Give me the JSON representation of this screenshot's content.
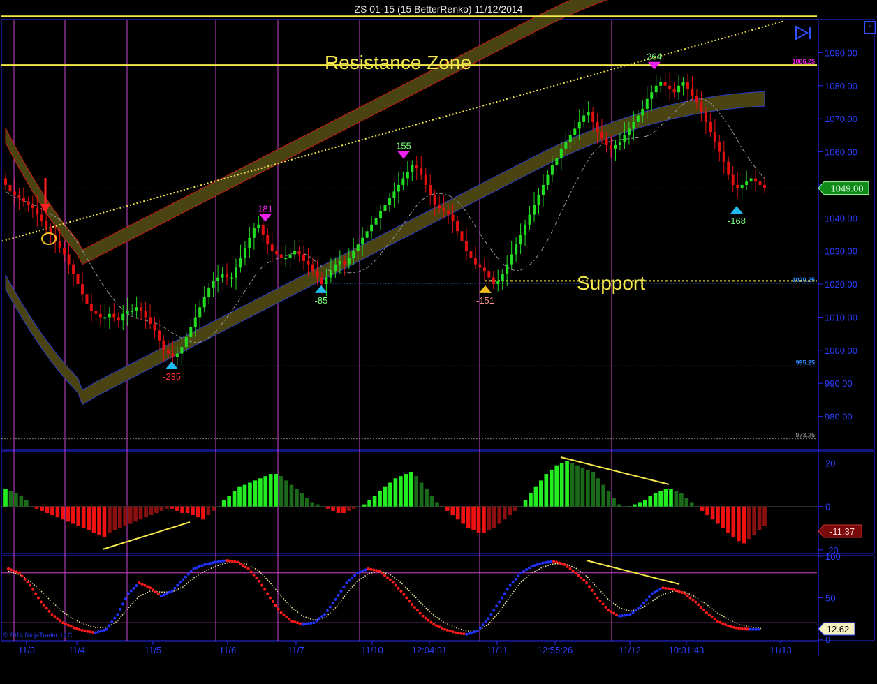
{
  "window": {
    "title": "ZS 01-15 (15 BetterRenko)  11/12/2014",
    "corner_button": "F",
    "copyright": "© 2014 NinjaTrader, LLC"
  },
  "colors": {
    "background": "#000000",
    "axis": "#2a2aff",
    "session_line": "#cc44cc",
    "up_bar": "#22dd22",
    "down_bar": "#e01010",
    "band": "#4a4412",
    "band_upper_edge": "#cc1a1a",
    "band_lower_edge": "#2b3bcc",
    "annotation": "#f5e84a",
    "swing_high": "#ee22ee",
    "swing_low": "#22bbee"
  },
  "chart_data": [
    {
      "type": "candlestick",
      "panel": "price",
      "ylim": [
        970,
        1100
      ],
      "y_ticks": [
        980,
        990,
        1000,
        1010,
        1020,
        1030,
        1040,
        1050,
        1060,
        1070,
        1080,
        1090
      ],
      "y_tick_labels": [
        "980.00",
        "990.00",
        "1000.00",
        "1010.00",
        "1020.00",
        "1030.00",
        "1040.00",
        "1050.00",
        "1060.00",
        "1070.00",
        "1080.00",
        "1090.00"
      ],
      "x_labels": [
        "11/3",
        "11/4",
        "11/5",
        "11/6",
        "11/7",
        "11/10",
        "12:04:31",
        "11/11",
        "12:55:26",
        "11/12",
        "10:31:43",
        "11/13"
      ],
      "last_price": 1049.0,
      "last_price_label": "1049.00",
      "horizontal_levels": [
        {
          "value": 1086.25,
          "label": "1086.25"
        },
        {
          "value": 1020.25,
          "label": "1020.25"
        },
        {
          "value": 995.25,
          "label": "995.25"
        },
        {
          "value": 973.25,
          "label": "973.25"
        }
      ],
      "resistance_lines": [
        1101,
        1086.25
      ],
      "annotations": [
        "Resistance Zone",
        "Support"
      ],
      "swing_highs": [
        {
          "label": "181",
          "price": 1039.5
        },
        {
          "label": "155",
          "price": 1058.5
        },
        {
          "label": "264",
          "price": 1085.5
        }
      ],
      "swing_lows": [
        {
          "label": "-235",
          "price": 996
        },
        {
          "label": "-85",
          "price": 1019
        },
        {
          "label": "-151",
          "price": 1019
        },
        {
          "label": "-168",
          "price": 1043
        }
      ],
      "closes": [
        1050,
        1048,
        1047,
        1046,
        1045,
        1044,
        1043,
        1041,
        1039,
        1037,
        1035,
        1033,
        1031,
        1029,
        1026,
        1023,
        1020,
        1017,
        1014,
        1012,
        1011,
        1010,
        1010,
        1011,
        1010,
        1009,
        1011,
        1012,
        1012,
        1013,
        1012,
        1010,
        1008,
        1006,
        1003,
        1000,
        999,
        998,
        999,
        1001,
        1004,
        1007,
        1010,
        1013,
        1016,
        1019,
        1021,
        1022,
        1023,
        1022,
        1022,
        1025,
        1028,
        1031,
        1034,
        1037,
        1038,
        1035,
        1032,
        1030,
        1029,
        1028,
        1028,
        1029,
        1030,
        1029,
        1027,
        1026,
        1024,
        1022,
        1020,
        1022,
        1024,
        1026,
        1027,
        1026,
        1028,
        1030,
        1032,
        1034,
        1036,
        1038,
        1040,
        1042,
        1044,
        1046,
        1048,
        1050,
        1052,
        1054,
        1056,
        1055,
        1053,
        1050,
        1047,
        1044,
        1043,
        1042,
        1041,
        1039,
        1036,
        1033,
        1030,
        1028,
        1026,
        1025,
        1024,
        1022,
        1020,
        1021,
        1023,
        1026,
        1029,
        1032,
        1035,
        1038,
        1041,
        1044,
        1047,
        1050,
        1053,
        1056,
        1058,
        1061,
        1063,
        1065,
        1067,
        1069,
        1071,
        1072,
        1069,
        1066,
        1064,
        1062,
        1061,
        1062,
        1063,
        1065,
        1067,
        1069,
        1071,
        1073,
        1076,
        1078,
        1080,
        1081,
        1080,
        1079,
        1078,
        1080,
        1081,
        1079,
        1077,
        1075,
        1072,
        1069,
        1066,
        1063,
        1060,
        1057,
        1053,
        1050,
        1049,
        1050,
        1051,
        1052,
        1051,
        1050,
        1049
      ]
    },
    {
      "type": "bar",
      "panel": "momentum_histogram",
      "ylim": [
        -22,
        25
      ],
      "y_ticks": [
        20,
        0,
        -20
      ],
      "y_tick_labels": [
        "20",
        "0",
        "-20"
      ],
      "last_value_label": "-11.37",
      "values": [
        8,
        7,
        6,
        5,
        3,
        0,
        -1,
        -2,
        -3,
        -4,
        -5,
        -6,
        -7,
        -8,
        -9,
        -10,
        -11,
        -12,
        -13,
        -14,
        -12,
        -11,
        -10,
        -9,
        -8,
        -7,
        -6,
        -5,
        -4,
        -3,
        -2,
        -1,
        -1,
        -2,
        -3,
        -3,
        -4,
        -5,
        -6,
        -4,
        -2,
        0,
        3,
        5,
        7,
        9,
        10,
        11,
        12,
        13,
        14,
        15,
        15,
        14,
        12,
        10,
        8,
        6,
        4,
        2,
        1,
        0,
        -1,
        -2,
        -3,
        -3,
        -2,
        -1,
        0,
        1,
        3,
        5,
        7,
        9,
        11,
        13,
        14,
        15,
        16,
        14,
        11,
        8,
        5,
        2,
        0,
        -2,
        -4,
        -6,
        -8,
        -10,
        -11,
        -12,
        -12,
        -11,
        -10,
        -8,
        -6,
        -4,
        -2,
        0,
        3,
        6,
        9,
        12,
        15,
        17,
        19,
        20,
        21,
        20,
        19,
        18,
        17,
        16,
        13,
        10,
        7,
        4,
        1,
        0,
        0,
        1,
        2,
        3,
        5,
        6,
        7,
        8,
        8,
        7,
        6,
        4,
        2,
        0,
        -2,
        -4,
        -6,
        -8,
        -10,
        -12,
        -14,
        -16,
        -17,
        -15,
        -13,
        -11,
        -9
      ]
    },
    {
      "type": "line",
      "panel": "oscillator",
      "ylim": [
        0,
        100
      ],
      "y_ticks": [
        100,
        50,
        0
      ],
      "y_tick_labels": [
        "100",
        "50",
        "0"
      ],
      "reference_lines": [
        80,
        20
      ],
      "last_value_label": "12.62",
      "series": [
        {
          "values": [
            85,
            80,
            65,
            45,
            30,
            20,
            14,
            10,
            8,
            12,
            30,
            55,
            68,
            62,
            52,
            58,
            72,
            85,
            90,
            93,
            95,
            93,
            85,
            70,
            50,
            32,
            22,
            18,
            20,
            30,
            48,
            68,
            80,
            85,
            82,
            72,
            58,
            42,
            28,
            18,
            12,
            8,
            6,
            10,
            25,
            45,
            65,
            80,
            88,
            92,
            94,
            90,
            80,
            68,
            50,
            35,
            28,
            30,
            40,
            55,
            62,
            60,
            55,
            45,
            32,
            22,
            16,
            13,
            12,
            12
          ]
        },
        {
          "values": [
            82,
            78,
            70,
            58,
            45,
            33,
            24,
            18,
            14,
            14,
            22,
            38,
            52,
            58,
            57,
            57,
            63,
            74,
            82,
            88,
            92,
            93,
            90,
            82,
            68,
            52,
            38,
            28,
            23,
            26,
            38,
            55,
            70,
            79,
            82,
            78,
            68,
            55,
            41,
            29,
            20,
            14,
            10,
            10,
            18,
            33,
            52,
            69,
            80,
            87,
            91,
            91,
            86,
            76,
            62,
            48,
            38,
            34,
            37,
            46,
            54,
            58,
            57,
            51,
            42,
            32,
            24,
            18,
            15,
            13
          ]
        }
      ]
    }
  ]
}
